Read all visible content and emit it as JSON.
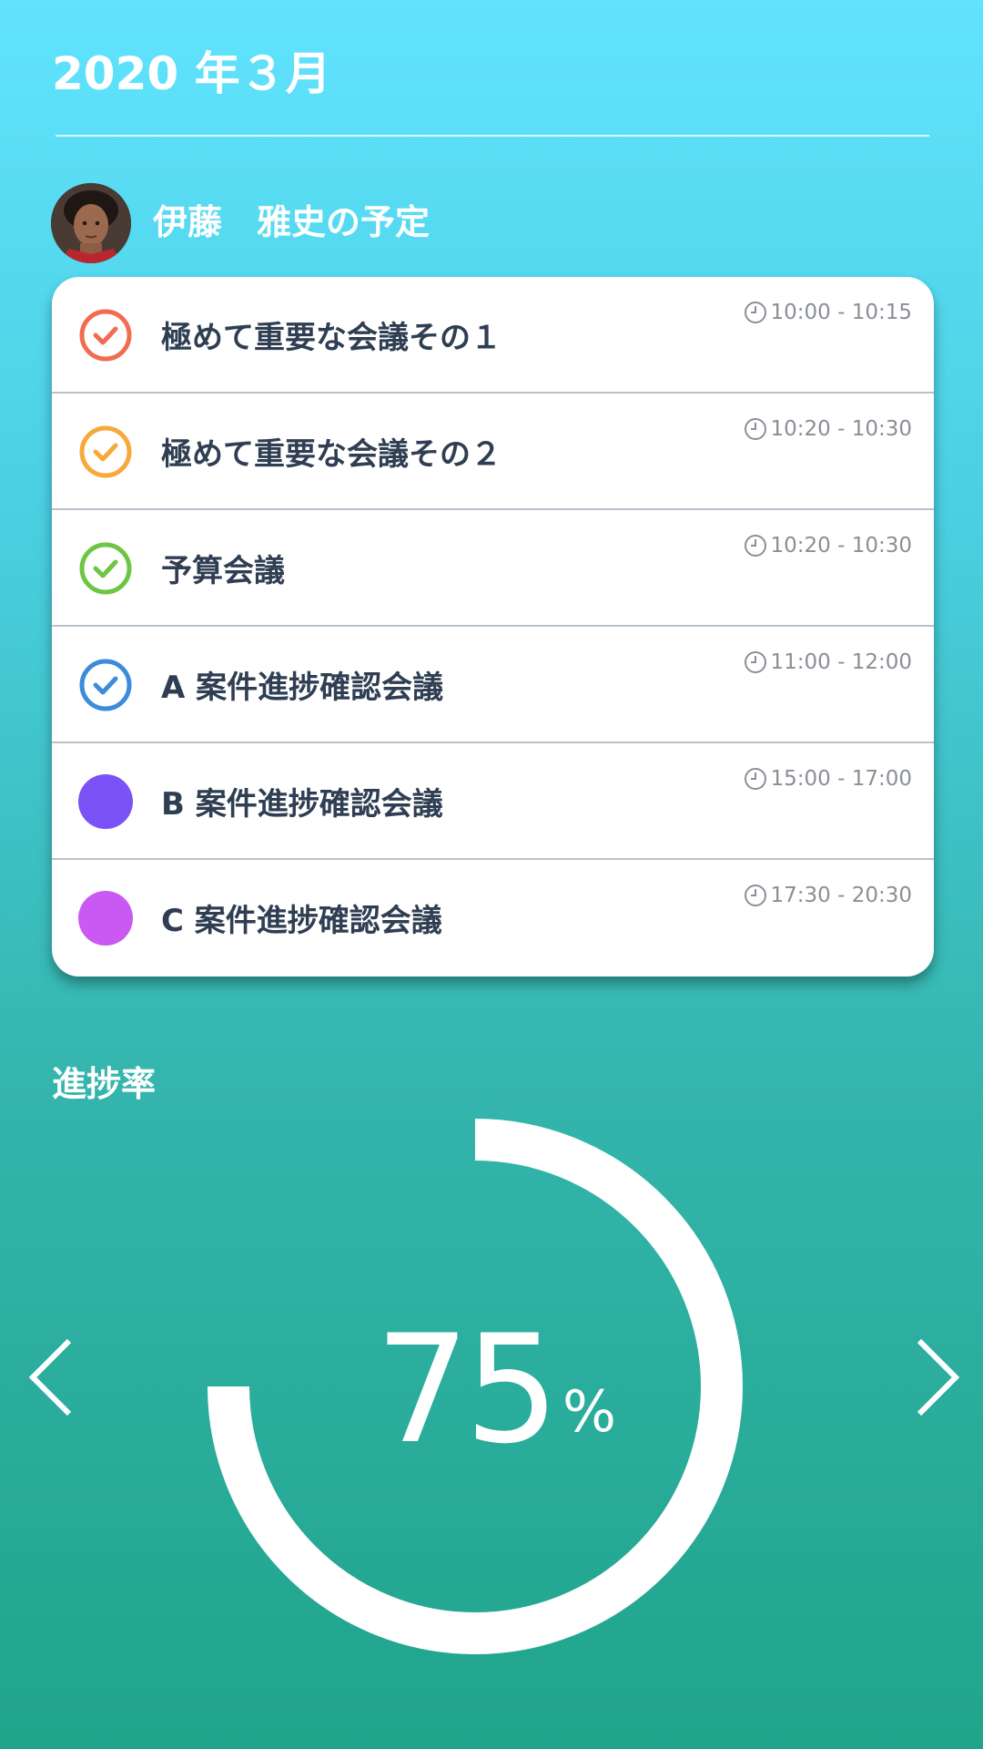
{
  "header": {
    "month_title": "2020 年３月"
  },
  "owner": {
    "label": "伊藤　雅史の予定"
  },
  "schedule": [
    {
      "title": "極めて重要な会議その１",
      "time": "10:00 - 10:15",
      "status": "done",
      "color": "#f26c4f"
    },
    {
      "title": "極めて重要な会議その２",
      "time": "10:20 - 10:30",
      "status": "done",
      "color": "#f7a93b"
    },
    {
      "title": "予算会議",
      "time": "10:20 - 10:30",
      "status": "done",
      "color": "#6cc644"
    },
    {
      "title": "A 案件進捗確認会議",
      "time": "11:00 - 12:00",
      "status": "done",
      "color": "#3c8cdb"
    },
    {
      "title": "B 案件進捗確認会議",
      "time": "15:00 - 17:00",
      "status": "pending",
      "color": "#7b52f5"
    },
    {
      "title": "C 案件進捗確認会議",
      "time": "17:30 - 20:30",
      "status": "pending",
      "color": "#c959f2"
    }
  ],
  "progress": {
    "label": "進捗率",
    "value": "75",
    "unit": "%",
    "fraction": 0.75
  },
  "navigation": {
    "prev_icon": "chevron-left-icon",
    "next_icon": "chevron-right-icon"
  },
  "colors": {
    "card_text": "#2f3e52",
    "time_text": "#8a8f96",
    "background_top": "#61e3fe",
    "background_bottom": "#20a48a"
  }
}
